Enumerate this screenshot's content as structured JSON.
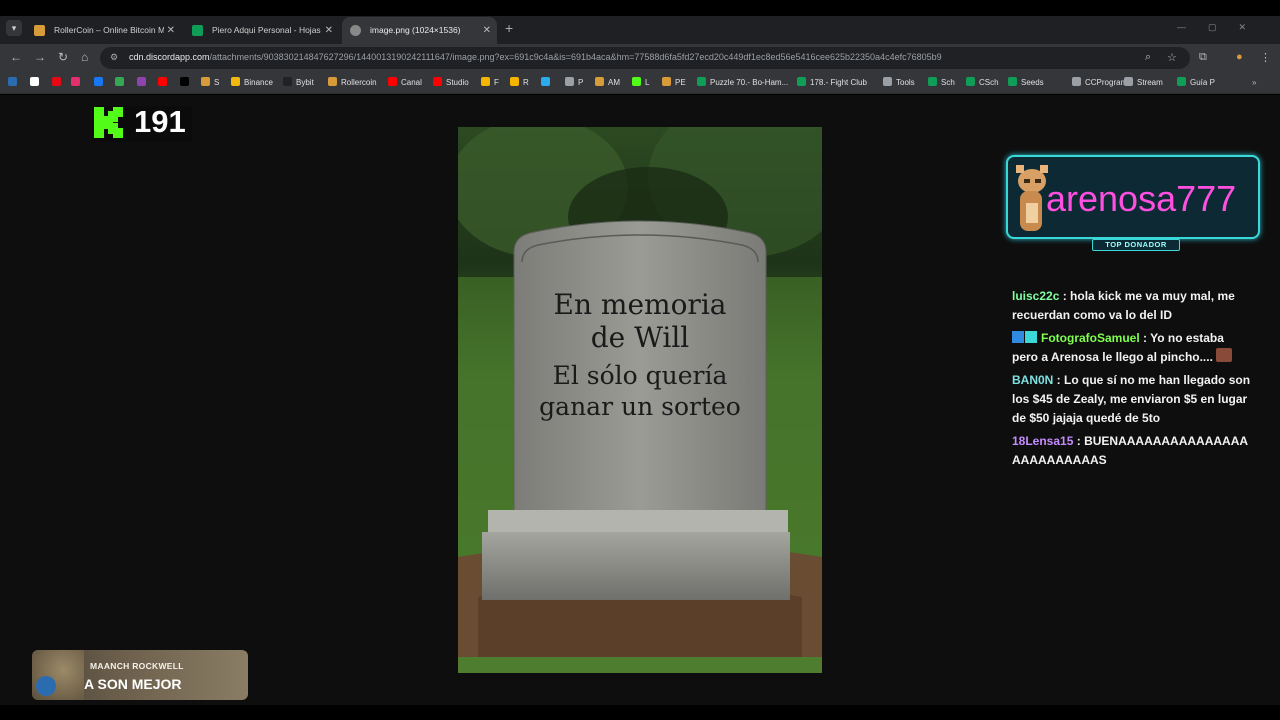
{
  "browser": {
    "tabs": [
      {
        "title": "RollerCoin – Online Bitcoin Mining",
        "active": false,
        "favicon": "rollercoin-hamster-icon"
      },
      {
        "title": "Piero Adqui Personal - Hojas de cálculo",
        "active": false,
        "favicon": "google-sheets-icon"
      },
      {
        "title": "image.png (1024×1536)",
        "active": true,
        "favicon": "globe-icon"
      }
    ],
    "url_host": "cdn.discordapp.com",
    "url_path": "/attachments/903830214847627296/1440013190242111647/image.png?ex=691c9c4a&is=691b4aca&hm=77588d6fa5fd27ecd20c449df1ec8ed56e5416cee625b22350a4c4efc76805b9",
    "bookmarks": [
      {
        "label": "",
        "color": "#2b6cb0"
      },
      {
        "label": "",
        "color": "#ffffff"
      },
      {
        "label": "",
        "color": "#e50914"
      },
      {
        "label": "",
        "color": "#e1306c"
      },
      {
        "label": "",
        "color": "#1877f2"
      },
      {
        "label": "",
        "color": "#34a853"
      },
      {
        "label": "",
        "color": "#8e44ad"
      },
      {
        "label": "",
        "color": "#ff0000"
      },
      {
        "label": "",
        "color": "#000000"
      },
      {
        "label": "S",
        "color": "#d79b3a"
      },
      {
        "label": "Binance",
        "color": "#f0b90b"
      },
      {
        "label": "Bybit",
        "color": "#222222"
      },
      {
        "label": "Rollercoin",
        "color": "#d79b3a"
      },
      {
        "label": "Canal",
        "color": "#ff0000"
      },
      {
        "label": "Studio",
        "color": "#ff0000"
      },
      {
        "label": "F",
        "color": "#f4b400"
      },
      {
        "label": "R",
        "color": "#f4b400"
      },
      {
        "label": "",
        "color": "#2aabee"
      },
      {
        "label": "P",
        "color": "#9aa0a6"
      },
      {
        "label": "AM",
        "color": "#d79b3a"
      },
      {
        "label": "L",
        "color": "#53fc18"
      },
      {
        "label": "PE",
        "color": "#d79b3a"
      },
      {
        "label": "Puzzle 70.- Bo-Ham...",
        "color": "#0f9d58"
      },
      {
        "label": "178.- Fight Club",
        "color": "#0f9d58"
      },
      {
        "label": "Tools",
        "color": "#9aa0a6"
      },
      {
        "label": "Sch",
        "color": "#0f9d58"
      },
      {
        "label": "CSch",
        "color": "#0f9d58"
      },
      {
        "label": "Seeds",
        "color": "#0f9d58"
      },
      {
        "label": "CCProgram",
        "color": "#9aa0a6"
      },
      {
        "label": "Stream",
        "color": "#9aa0a6"
      },
      {
        "label": "Guía P",
        "color": "#0f9d58"
      }
    ]
  },
  "kick": {
    "count": "191",
    "color": "#53fc18"
  },
  "tombstone": {
    "line1": "En memoria",
    "line2": "de Will",
    "line3": "El sólo quería",
    "line4": "ganar un sorteo"
  },
  "donor": {
    "name": "arenosa777",
    "label": "TOP DONADOR",
    "name_color": "#ff4fe0"
  },
  "chat": [
    {
      "user": "luisc22c",
      "user_color": "#7fffa0",
      "text": "hola kick me va muy mal, me recuerdan como va lo del ID",
      "badges": []
    },
    {
      "user": "FotografoSamuel",
      "user_color": "#7fff50",
      "text": "Yo no estaba pero a Arenosa le llego al pincho....",
      "badges": [
        "verified-badge-icon",
        "sub-badge-icon"
      ]
    },
    {
      "user": "BAN0N",
      "user_color": "#7fe0e0",
      "text": "Lo que sí no me han llegado son los $45 de Zealy, me enviaron $5 en lugar de $50 jajaja quedé de 5to",
      "badges": []
    },
    {
      "user": "18Lensa15",
      "user_color": "#c58cff",
      "text": "BUENAAAAAAAAAAAAAAAAAAAAAAAAAS",
      "badges": []
    }
  ],
  "lower_third": {
    "name": "MAANCH ROCKWELL",
    "text": "A SON MEJOR"
  }
}
